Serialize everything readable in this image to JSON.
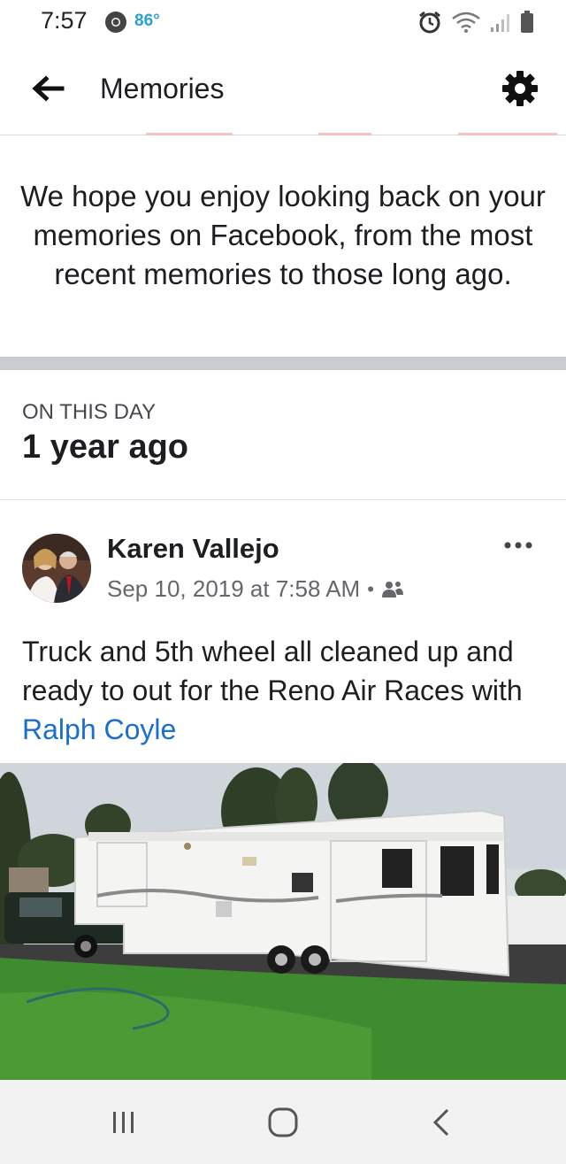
{
  "status_bar": {
    "time": "7:57",
    "temperature": "86°",
    "icons": [
      "chrome-icon",
      "alarm-icon",
      "wifi-icon",
      "signal-icon",
      "battery-icon"
    ]
  },
  "app_bar": {
    "title": "Memories",
    "back_icon": "arrow-left-icon",
    "settings_icon": "gear-icon"
  },
  "intro": {
    "text": "We hope you enjoy looking back on your memories on Facebook, from the most recent memories to those long ago."
  },
  "on_this_day": {
    "label": "ON THIS DAY",
    "title": "1 year ago"
  },
  "post": {
    "author": "Karen Vallejo",
    "timestamp": "Sep 10, 2019 at 7:58 AM",
    "audience_icon": "friends-icon",
    "text": "Truck and 5th wheel all cleaned up and ready to out for the Reno Air Races with",
    "mention": "Ralph Coyle",
    "more_icon": "more-options-icon"
  },
  "colors": {
    "link": "#1b6ecf",
    "temperature": "#2a9fd6",
    "separator": "#c9ccd1"
  },
  "navigation_bar": {
    "buttons": [
      "recent-apps-icon",
      "home-icon",
      "back-icon"
    ]
  }
}
